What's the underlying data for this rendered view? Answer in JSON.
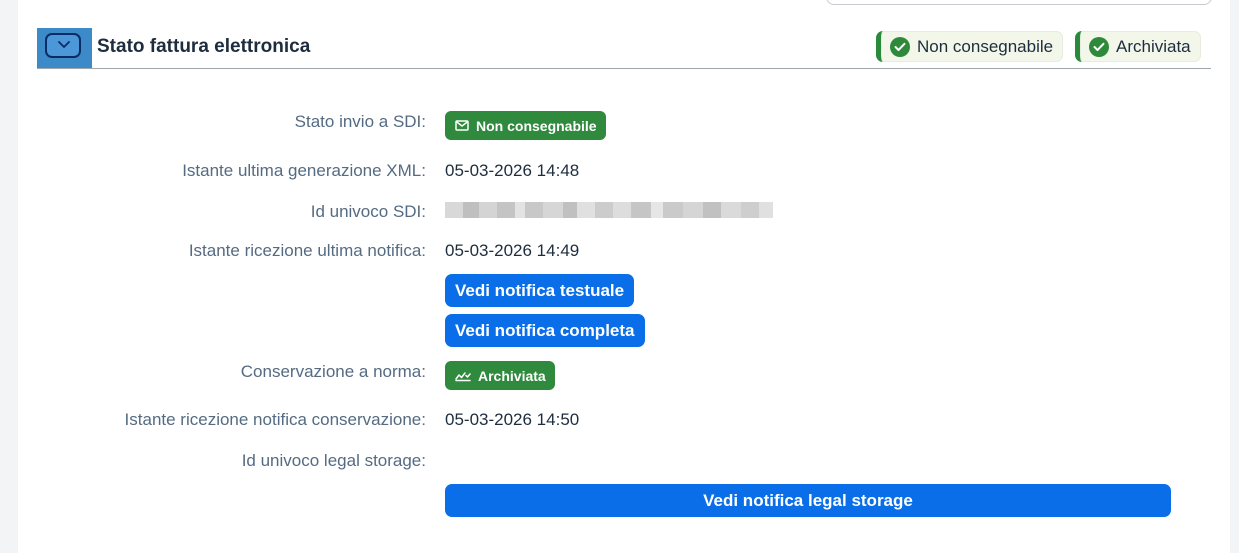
{
  "header": {
    "title": "Stato fattura elettronica",
    "chips": [
      {
        "label": "Non consegnabile"
      },
      {
        "label": "Archiviata"
      }
    ]
  },
  "fields": {
    "stato_invio": {
      "label": "Stato invio a SDI:",
      "badge": "Non consegnabile",
      "icon": "envelope-icon"
    },
    "istante_xml": {
      "label": "Istante ultima generazione XML:",
      "value": "05-03-2026 14:48"
    },
    "id_sdi": {
      "label": "Id univoco SDI:"
    },
    "istante_notifica": {
      "label": "Istante ricezione ultima notifica:",
      "value": "05-03-2026 14:49"
    },
    "conservazione": {
      "label": "Conservazione a norma:",
      "badge": "Archiviata",
      "icon": "archive-check-icon"
    },
    "istante_conservazione": {
      "label": "Istante ricezione notifica conservazione:",
      "value": "05-03-2026 14:50"
    },
    "id_legal_storage": {
      "label": "Id univoco legal storage:"
    }
  },
  "buttons": {
    "notifica_testuale": "Vedi notifica testuale",
    "notifica_completa": "Vedi notifica completa",
    "notifica_legal_storage": "Vedi notifica legal storage"
  },
  "colors": {
    "success": "#2f8a3d",
    "primary_button": "#0a6ee8",
    "header_accent": "#3d8ac9"
  }
}
